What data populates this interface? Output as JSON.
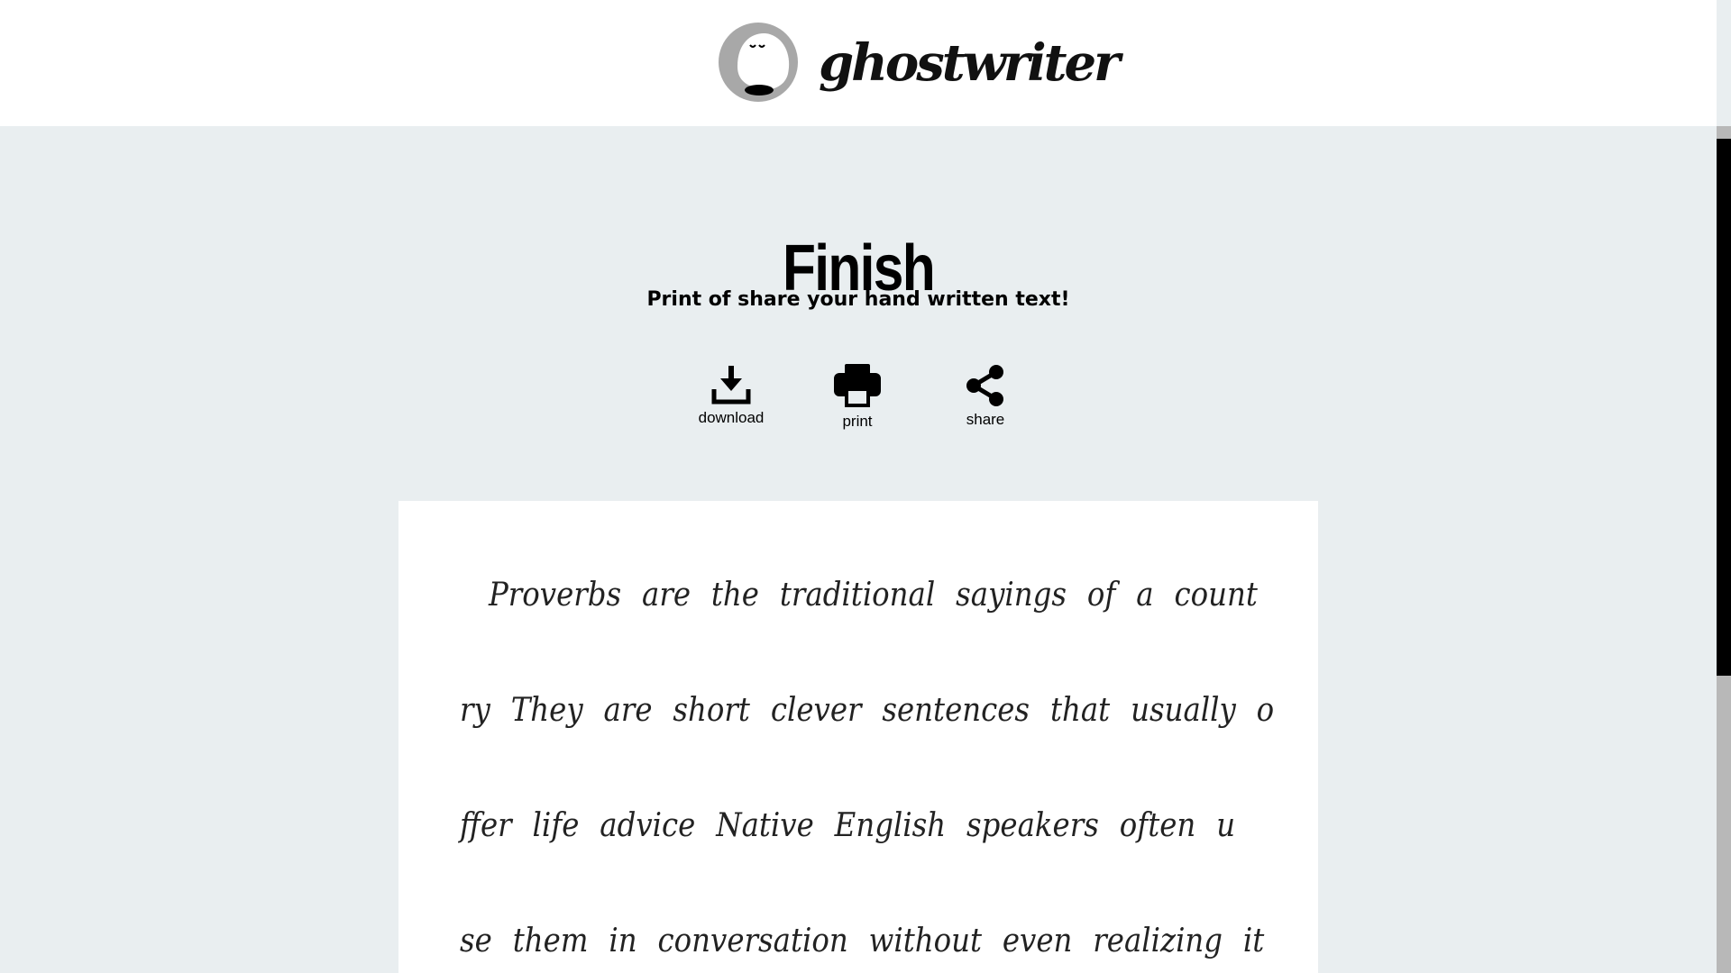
{
  "header": {
    "brand_name": "ghostwriter",
    "logo_icon": "ghost-icon"
  },
  "main": {
    "title": "Finish",
    "subtitle": "Print of share your hand written text!",
    "actions": [
      {
        "label": "download",
        "icon": "download-icon"
      },
      {
        "label": "print",
        "icon": "printer-icon"
      },
      {
        "label": "share",
        "icon": "share-icon"
      }
    ]
  },
  "paper": {
    "lines": [
      "Proverbs are the traditional sayings of a count",
      "ry They are short clever sentences that usually o",
      "ffer life advice Native English speakers often u",
      "se them in conversation without even realizing it"
    ]
  },
  "colors": {
    "background": "#e9eef0",
    "header_bg": "#ffffff",
    "paper_bg": "#ffffff",
    "text": "#000000",
    "logo_gray": "#a8a8a8"
  }
}
